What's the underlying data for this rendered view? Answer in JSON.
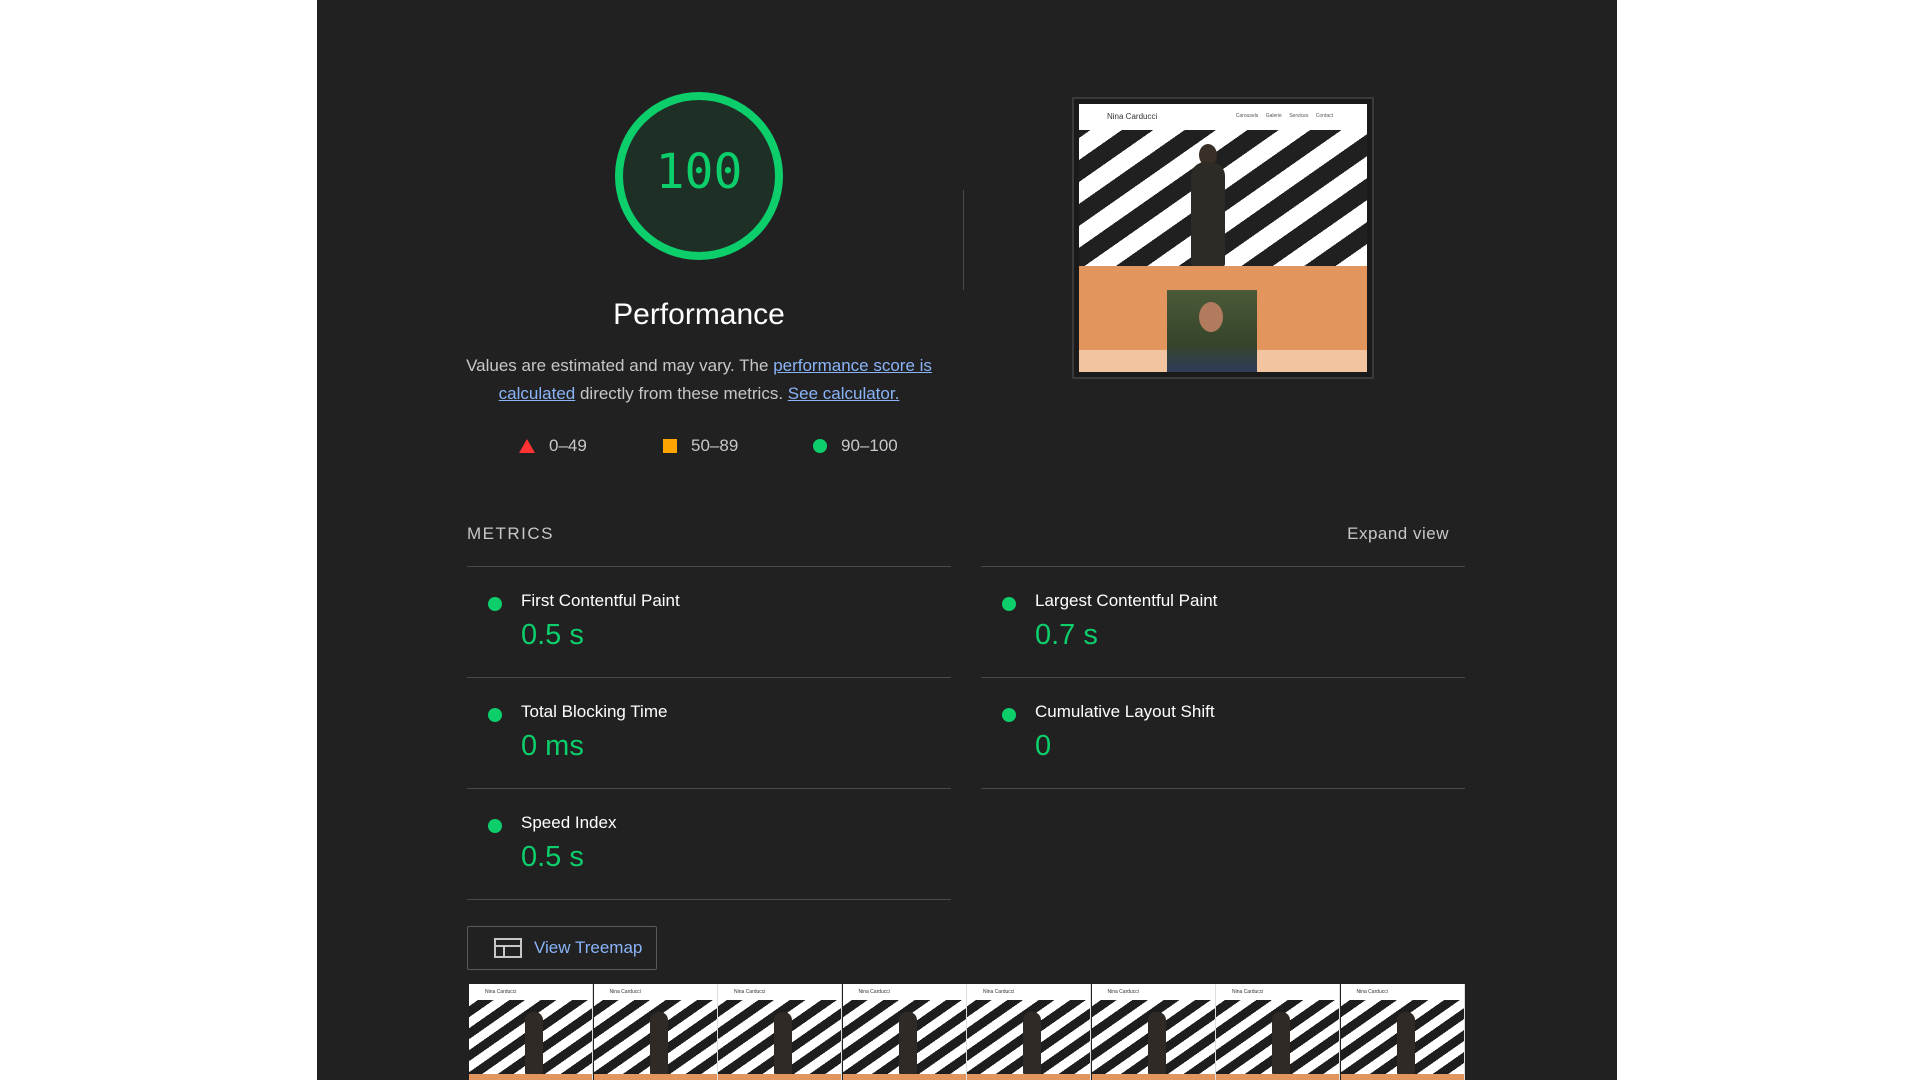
{
  "performance": {
    "score": "100",
    "title": "Performance",
    "description_prefix": "Values are estimated and may vary. The ",
    "link_score": "performance score is calculated",
    "description_mid": " directly from these metrics. ",
    "link_calculator": "See calculator.",
    "legend": [
      {
        "icon": "triangle-icon",
        "range": "0–49",
        "color": "#ff3333"
      },
      {
        "icon": "square-icon",
        "range": "50–89",
        "color": "#ffa400"
      },
      {
        "icon": "circle-icon",
        "range": "90–100",
        "color": "#0cce6b"
      }
    ],
    "score_fraction": 1.0
  },
  "screenshot": {
    "site_brand": "Nina Carducci",
    "nav_links": "Carousels Galerie Services Contact"
  },
  "metrics": {
    "title": "METRICS",
    "expand_label": "Expand view",
    "items": [
      {
        "name": "First Contentful Paint",
        "value": "0.5 s",
        "status": "pass"
      },
      {
        "name": "Largest Contentful Paint",
        "value": "0.7 s",
        "status": "pass"
      },
      {
        "name": "Total Blocking Time",
        "value": "0 ms",
        "status": "pass"
      },
      {
        "name": "Cumulative Layout Shift",
        "value": "0",
        "status": "pass"
      },
      {
        "name": "Speed Index",
        "value": "0.5 s",
        "status": "pass"
      }
    ]
  },
  "treemap": {
    "label": "View Treemap",
    "icon": "treemap-icon"
  },
  "filmstrip": {
    "frame_label": "Nina Carducci",
    "frame_count": 8
  },
  "colors": {
    "pass": "#0cce6b",
    "average": "#ffa400",
    "fail": "#ff3333",
    "link": "#8ab4f8",
    "background": "#212121"
  }
}
